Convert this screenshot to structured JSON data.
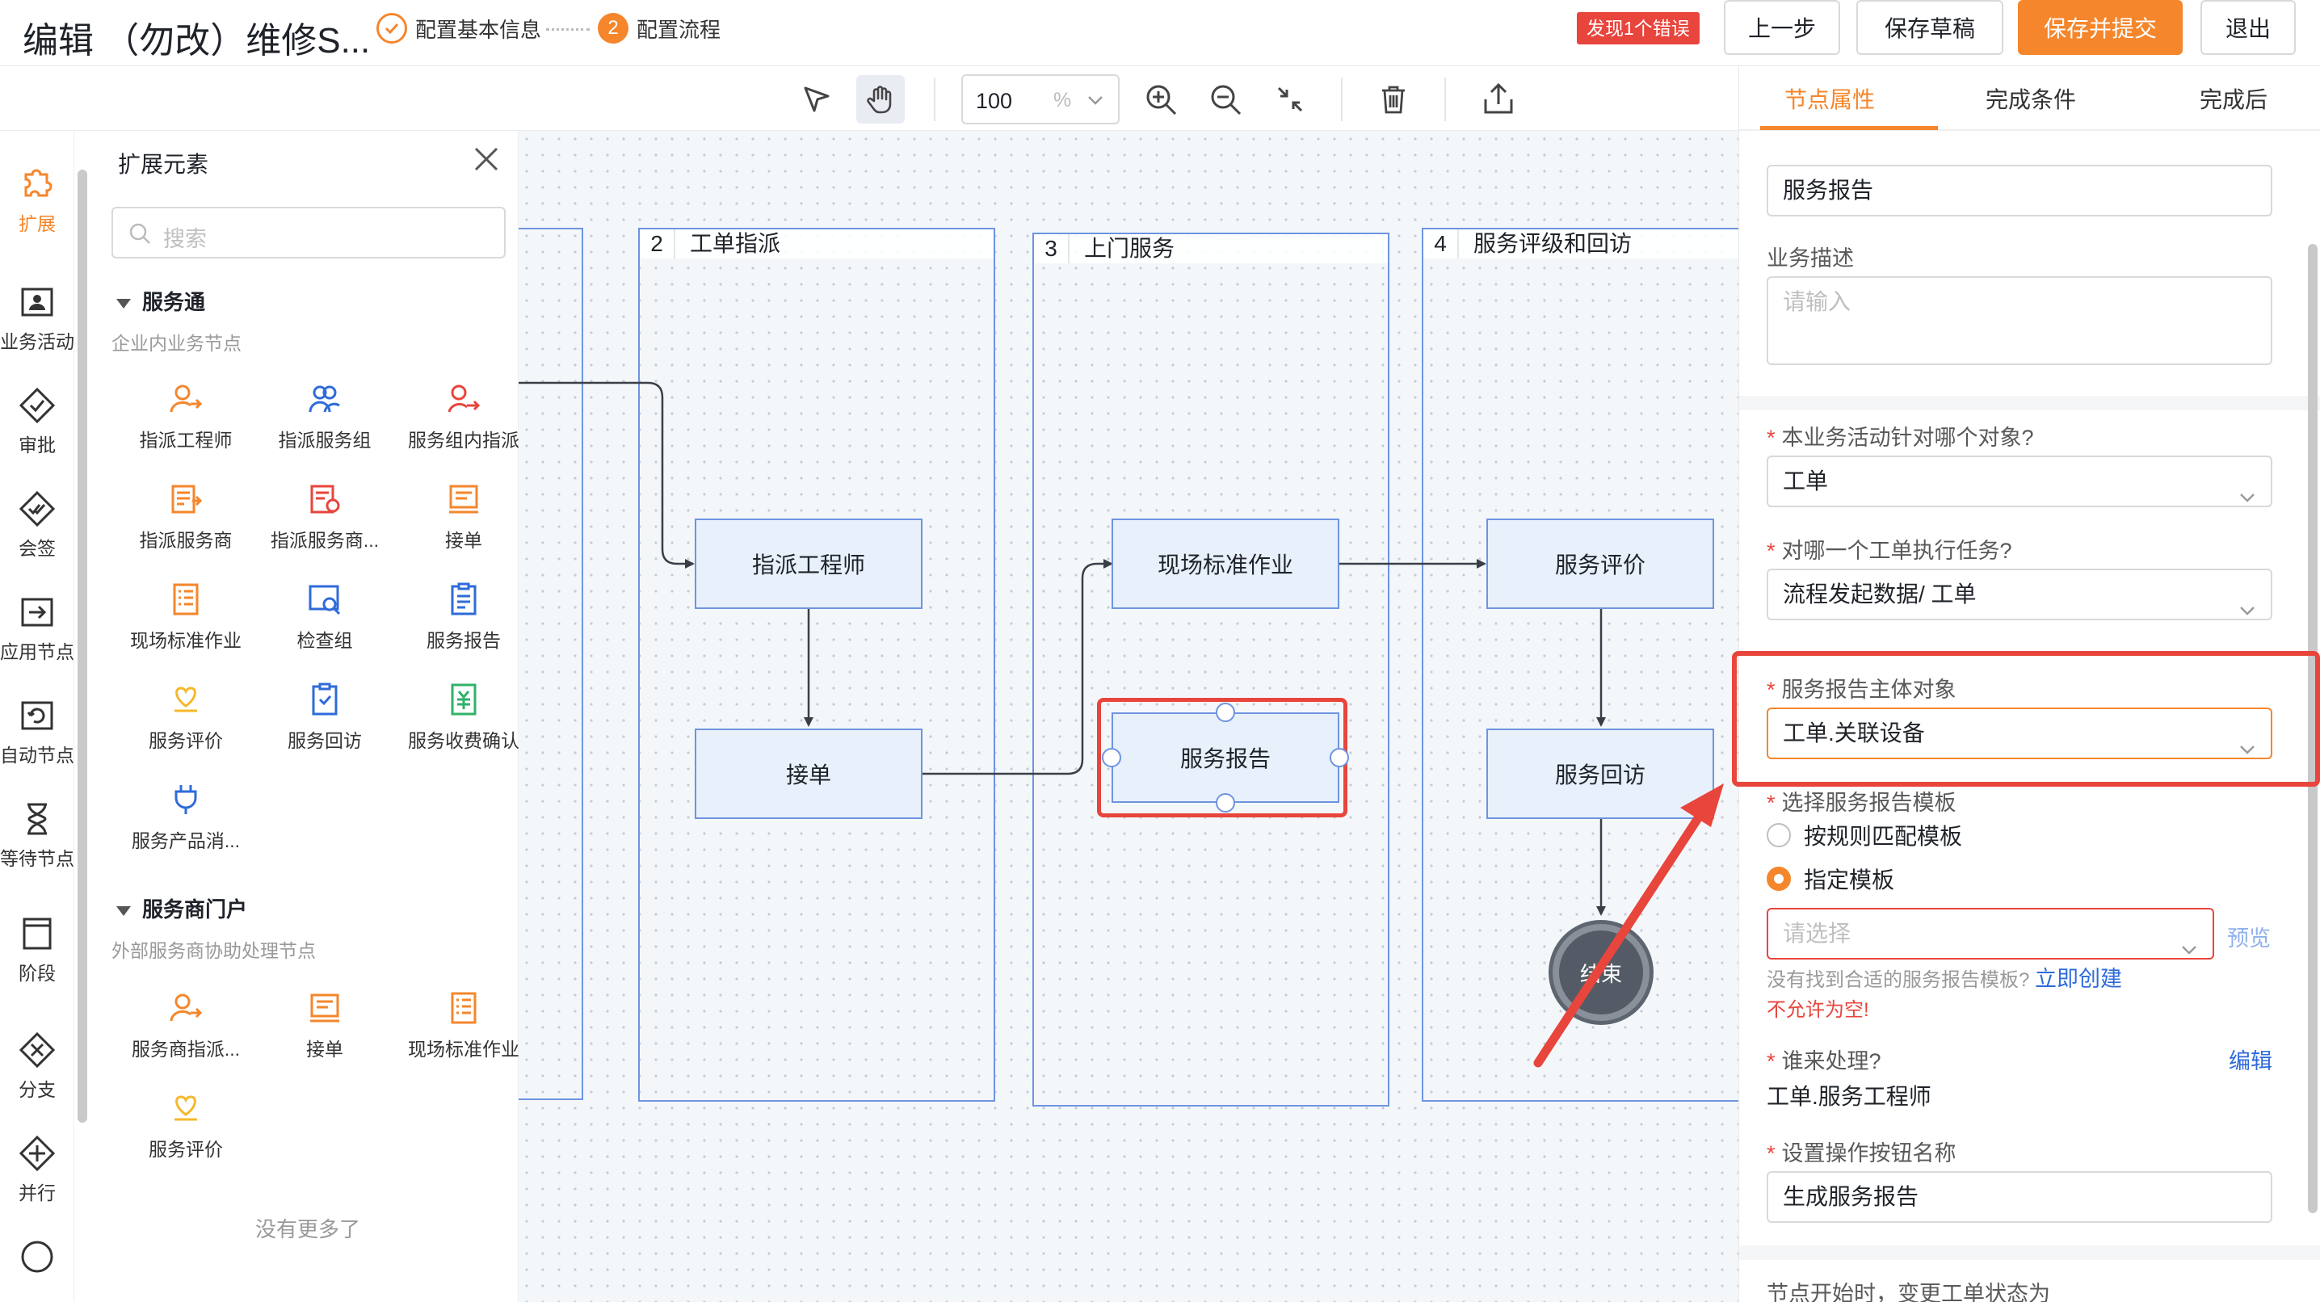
{
  "header": {
    "title": "编辑 （勿改）维修S...",
    "steps": [
      {
        "label": "配置基本信息",
        "state": "done"
      },
      {
        "label": "配置流程",
        "number": "2",
        "state": "current"
      }
    ],
    "error_badge": "发现1个错误",
    "buttons": {
      "prev": "上一步",
      "save_draft": "保存草稿",
      "save_submit": "保存并提交",
      "exit": "退出"
    },
    "accent_color": "#f5862b",
    "error_color": "#e8453c"
  },
  "toolbar": {
    "zoom_value": "100",
    "zoom_unit": "%",
    "tools": [
      "pointer-icon",
      "hand-icon",
      "zoom-in-icon",
      "zoom-out-icon",
      "fit-icon",
      "delete-icon",
      "export-icon"
    ]
  },
  "rail": {
    "items": [
      {
        "label": "扩展",
        "icon": "puzzle-icon",
        "active": true
      },
      {
        "label": "业务活动",
        "icon": "user-card-icon"
      },
      {
        "label": "审批",
        "icon": "diamond-check-icon"
      },
      {
        "label": "会签",
        "icon": "diamond-double-check-icon"
      },
      {
        "label": "应用节点",
        "icon": "app-enter-icon"
      },
      {
        "label": "自动节点",
        "icon": "auto-loop-icon"
      },
      {
        "label": "等待节点",
        "icon": "hourglass-icon"
      },
      {
        "label": "阶段",
        "icon": "stage-icon"
      },
      {
        "label": "分支",
        "icon": "diamond-x-icon"
      },
      {
        "label": "并行",
        "icon": "diamond-plus-icon"
      },
      {
        "label": "",
        "icon": "circle-end-icon"
      }
    ]
  },
  "extension": {
    "title": "扩展元素",
    "search_placeholder": "搜索",
    "groups": [
      {
        "title": "服务通",
        "subtitle": "企业内业务节点",
        "items": [
          "指派工程师",
          "指派服务组",
          "服务组内指派",
          "指派服务商",
          "指派服务商...",
          "接单",
          "现场标准作业",
          "检查组",
          "服务报告",
          "服务评价",
          "服务回访",
          "服务收费确认",
          "服务产品消..."
        ]
      },
      {
        "title": "服务商门户",
        "subtitle": "外部服务商协助处理节点",
        "items": [
          "服务商指派...",
          "接单",
          "现场标准作业",
          "服务评价"
        ]
      }
    ],
    "no_more": "没有更多了"
  },
  "canvas": {
    "lanes": [
      {
        "number": "2",
        "name": "工单指派"
      },
      {
        "number": "3",
        "name": "上门服务"
      },
      {
        "number": "4",
        "name": "服务评级和回访"
      }
    ],
    "nodes": {
      "assign_engineer": "指派工程师",
      "accept": "接单",
      "onsite": "现场标准作业",
      "report": "服务报告",
      "evaluate": "服务评价",
      "revisit": "服务回访",
      "end": "结束"
    }
  },
  "props": {
    "tabs": [
      "节点属性",
      "完成条件",
      "完成后"
    ],
    "node_name": "服务报告",
    "desc_label": "业务描述",
    "desc_placeholder": "请输入",
    "target_label": "本业务活动针对哪个对象?",
    "target_value": "工单",
    "which_label": "对哪一个工单执行任务?",
    "which_value": "流程发起数据/ 工单",
    "subject_label": "服务报告主体对象",
    "subject_value": "工单.关联设备",
    "template_label": "选择服务报告模板",
    "radio_rule": "按规则匹配模板",
    "radio_specified": "指定模板",
    "template_placeholder": "请选择",
    "preview": "预览",
    "no_template_hint": "没有找到合适的服务报告模板?",
    "create_now": "立即创建",
    "not_empty": "不允许为空!",
    "handler_label": "谁来处理?",
    "edit": "编辑",
    "handler_value": "工单.服务工程师",
    "button_name_label": "设置操作按钮名称",
    "button_name_value": "生成服务报告",
    "status_label": "节点开始时，变更工单状态为"
  }
}
